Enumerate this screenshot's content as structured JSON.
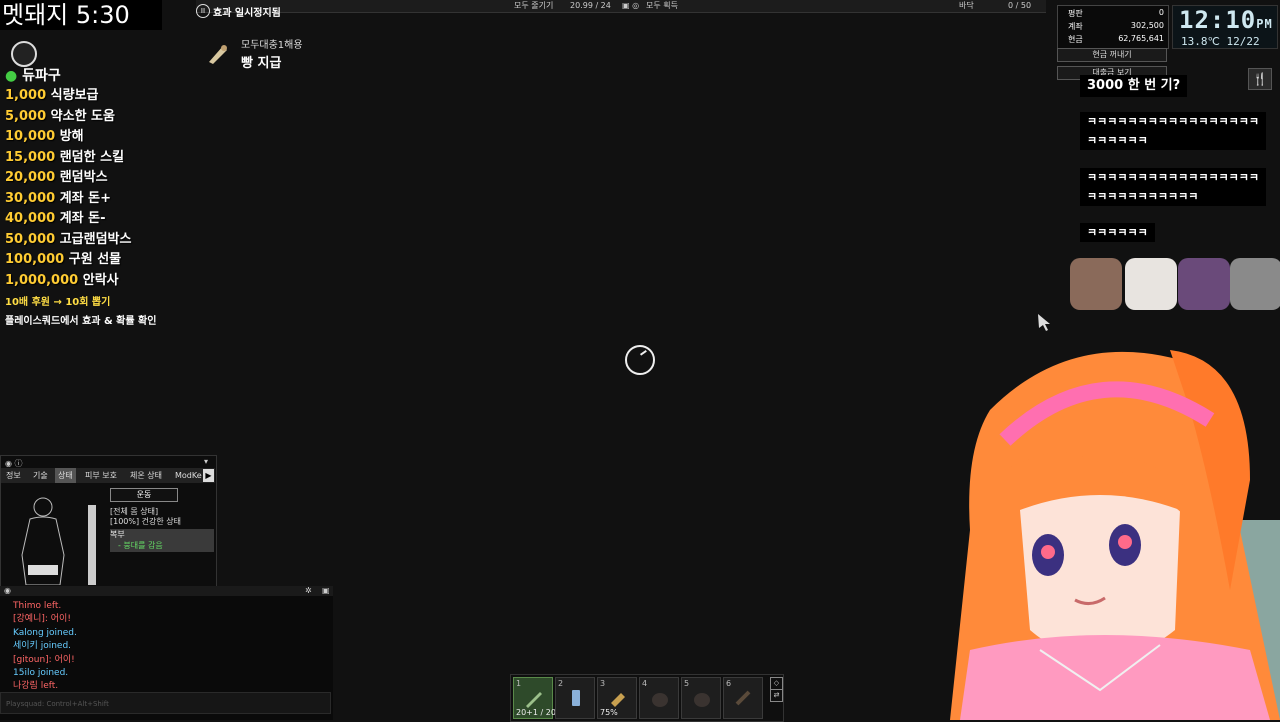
{
  "timer": {
    "label": "멧돼지 5:30"
  },
  "donation": {
    "title": "듀파구",
    "items": [
      {
        "amount": "1,000",
        "label": "식량보급"
      },
      {
        "amount": "5,000",
        "label": "약소한 도움"
      },
      {
        "amount": "10,000",
        "label": "방해"
      },
      {
        "amount": "15,000",
        "label": "랜덤한 스킬"
      },
      {
        "amount": "20,000",
        "label": "랜덤박스"
      },
      {
        "amount": "30,000",
        "label": "계좌 돈+"
      },
      {
        "amount": "40,000",
        "label": "계좌 돈-"
      },
      {
        "amount": "50,000",
        "label": "고급랜덤박스"
      },
      {
        "amount": "100,000",
        "label": "구원 선물"
      },
      {
        "amount": "1,000,000",
        "label": "안락사"
      }
    ],
    "note1": "10배 후원 → 10회 뽑기",
    "note2": "플레이스쿼드에서 효과 & 확률 확인"
  },
  "topbar": {
    "pause_label": "효과 일시정지됨",
    "center_left": "모두 줄기기",
    "progress": "20.99 / 24",
    "center_right": "모두 획득",
    "right_label": "바닥",
    "capacity": "0 / 50"
  },
  "notification": {
    "line1": "모두대충1해용",
    "line2": "빵 지급"
  },
  "status": {
    "rows": [
      {
        "label": "평판",
        "value": "0"
      },
      {
        "label": "계좌",
        "value": "302,500"
      },
      {
        "label": "현금",
        "value": "62,765,641"
      }
    ],
    "cash_button": "현금 꺼내기",
    "loan_button": "대출금 보기"
  },
  "clock": {
    "time": "12:10",
    "time_suffix": "PM",
    "temp": "13.8℃",
    "date": "12/22"
  },
  "chat_bubbles": [
    [
      "3000 한 번 기?"
    ],
    [
      "ㅋㅋㅋㅋㅋㅋㅋㅋㅋㅋㅋㅋㅋㅋㅋㅋㅋ",
      "ㅋㅋㅋㅋㅋㅋ"
    ],
    [
      "ㅋㅋㅋㅋㅋㅋㅋㅋㅋㅋㅋㅋㅋㅋㅋㅋㅋ",
      "ㅋㅋㅋㅋㅋㅋㅋㅋㅋㅋㅋ"
    ],
    [
      "ㅋㅋㅋㅋㅋㅋ"
    ]
  ],
  "char_panel": {
    "tabs": [
      "정보",
      "기술",
      "상태",
      "피부 보호",
      "체온 상태",
      "ModKe"
    ],
    "exercise": "운동",
    "health_lines": [
      "[전체 몸 상태]",
      "[100%] 건강한 상태"
    ],
    "abdomen_title": "복부",
    "abdomen_status": "- 붕대를 감음"
  },
  "chat_log": {
    "lines": [
      {
        "text": "Thimo left.",
        "color": "#ff6666"
      },
      {
        "text": "[강예니]: 어이!",
        "color": "#ff6666"
      },
      {
        "text": "Kalong joined.",
        "color": "#66ccff"
      },
      {
        "text": "세이키 joined.",
        "color": "#66ccff"
      },
      {
        "text": "[gitoun]: 어이!",
        "color": "#ff6666"
      },
      {
        "text": "15ilo joined.",
        "color": "#66ccff"
      },
      {
        "text": "나강림 left.",
        "color": "#ff6666"
      }
    ],
    "input_hint": "Playsquad: Control+Alt+Shift"
  },
  "hotbar": {
    "slots": [
      {
        "num": "1",
        "count": "20+1 / 20",
        "icon": "rifle-icon"
      },
      {
        "num": "2",
        "count": "",
        "icon": "phone-icon"
      },
      {
        "num": "3",
        "count": "75%",
        "icon": "flashlight-icon"
      },
      {
        "num": "4",
        "count": "",
        "icon": "bag-icon"
      },
      {
        "num": "5",
        "count": "",
        "icon": "bag-icon"
      },
      {
        "num": "6",
        "count": "",
        "icon": "belt-icon"
      }
    ]
  }
}
